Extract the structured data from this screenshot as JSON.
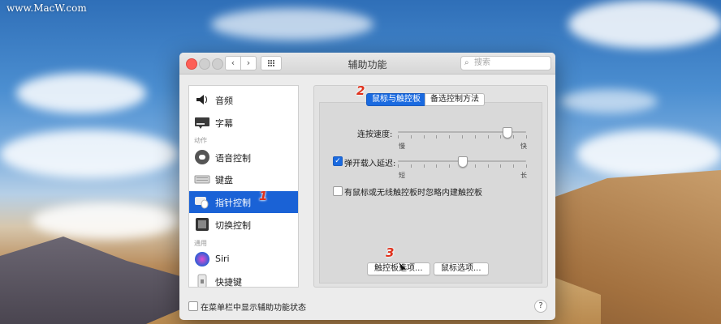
{
  "watermark": "www.MacW.com",
  "window": {
    "title": "辅助功能",
    "search_placeholder": "搜索"
  },
  "sidebar": {
    "items": [
      {
        "label": "音频",
        "icon": "speaker-icon"
      },
      {
        "label": "字幕",
        "icon": "captions-icon"
      },
      {
        "label": "语音控制",
        "icon": "voice-control-icon"
      },
      {
        "label": "键盘",
        "icon": "keyboard-icon"
      },
      {
        "label": "指针控制",
        "icon": "pointer-control-icon",
        "selected": true
      },
      {
        "label": "切换控制",
        "icon": "switch-control-icon"
      },
      {
        "label": "Siri",
        "icon": "siri-icon"
      },
      {
        "label": "快捷键",
        "icon": "shortcut-icon"
      }
    ],
    "section_motor": "动作",
    "section_general": "通用"
  },
  "tabs": {
    "mouse_trackpad": "鼠标与触控板",
    "alt_control": "备选控制方法"
  },
  "settings": {
    "double_click_label": "连按速度:",
    "double_click_slow": "慢",
    "double_click_fast": "快",
    "double_click_value_pct": 0.85,
    "spring_loading_label": "弹开载入延迟:",
    "spring_loading_checked": true,
    "spring_short": "短",
    "spring_long": "长",
    "spring_value_pct": 0.5,
    "ignore_trackpad_label": "有鼠标或无线触控板时忽略内建触控板",
    "ignore_trackpad_checked": false
  },
  "buttons": {
    "trackpad_options": "触控板选项...",
    "mouse_options": "鼠标选项..."
  },
  "footer": {
    "show_status_label": "在菜单栏中显示辅助功能状态",
    "show_status_checked": false,
    "help": "?"
  },
  "annotations": {
    "step1": "1",
    "step2": "2",
    "step3": "3"
  },
  "colors": {
    "accent": "#1a6ae0",
    "selected_row": "#1a62d6",
    "step_marker": "#e0321d"
  }
}
